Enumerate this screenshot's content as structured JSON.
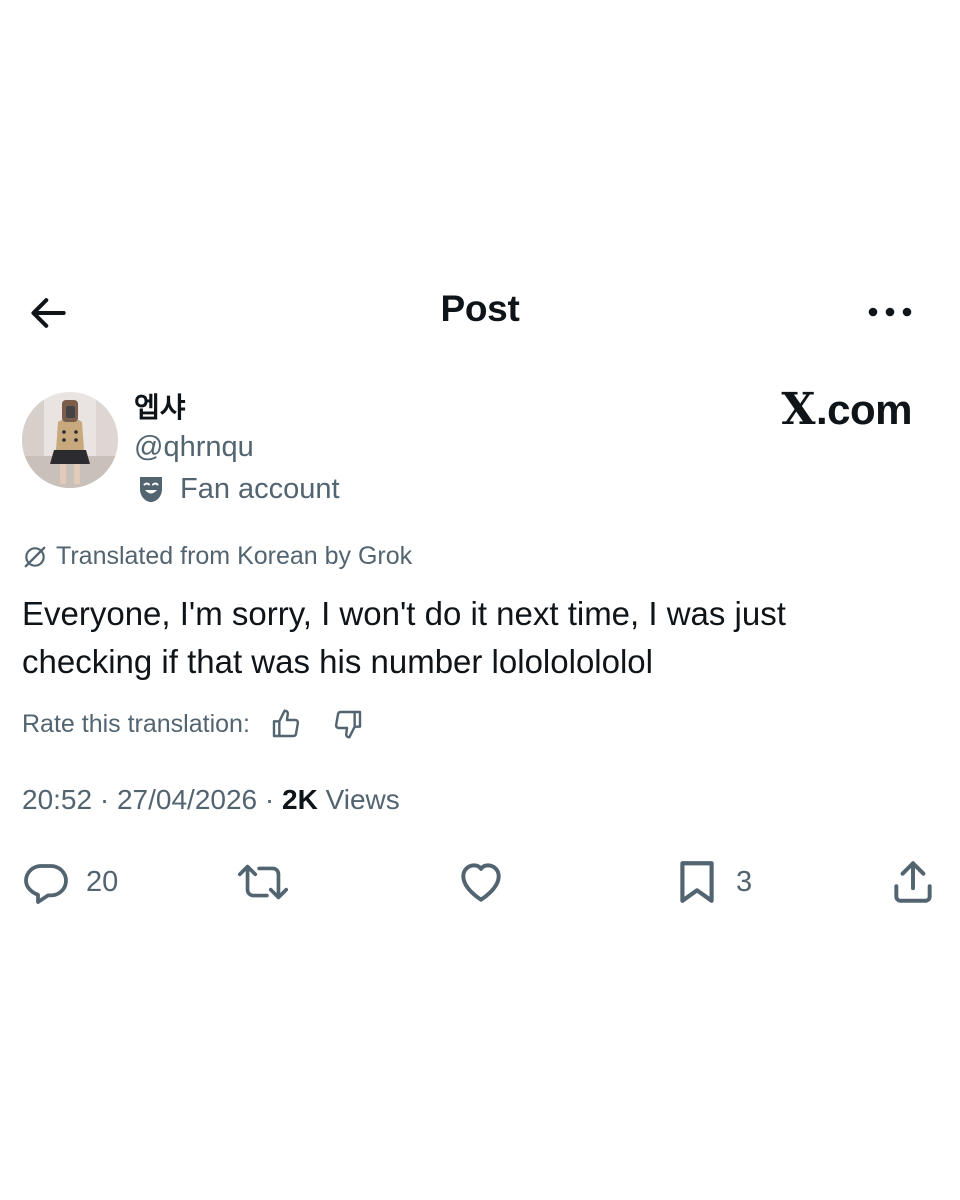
{
  "header": {
    "title": "Post",
    "back_icon": "arrow-left-icon",
    "more_icon": "more-horizontal-icon"
  },
  "author": {
    "display_name": "엡샤",
    "handle": "@qhrnqu",
    "affiliation_label": "Fan account",
    "affiliation_icon": "theater-mask-icon"
  },
  "brand": {
    "x_glyph": "X",
    "rest": ".com"
  },
  "translation": {
    "notice": "Translated from Korean by Grok",
    "rate_label": "Rate this translation:"
  },
  "post": {
    "text": "Everyone, I'm sorry, I won't do it next time, I was just checking if that was his number lolololololol"
  },
  "meta": {
    "time": "20:52",
    "separator": " · ",
    "date": "27/04/2026",
    "views_count": "2K",
    "views_label": " Views"
  },
  "actions": {
    "replies": "20",
    "bookmarks": "3"
  },
  "colors": {
    "text": "#0f1419",
    "secondary": "#536471",
    "background": "#ffffff"
  }
}
